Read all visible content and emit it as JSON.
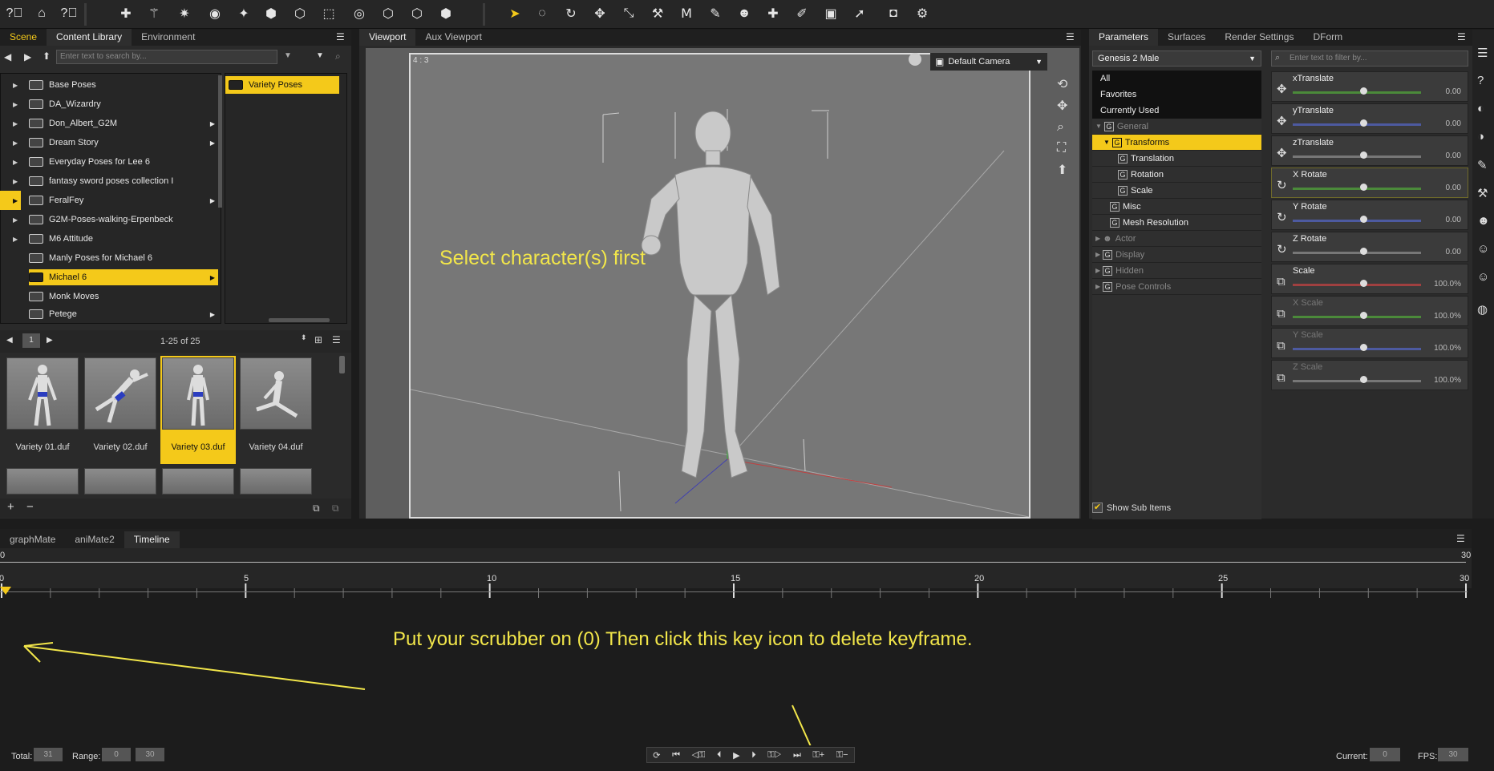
{
  "toolbar": {
    "icons": [
      "help-icon",
      "home-icon",
      "help-icon",
      "scene-icon",
      "tool-icon"
    ]
  },
  "left": {
    "tabs": [
      "Scene",
      "Content Library",
      "Environment"
    ],
    "search_placeholder": "Enter text to search by...",
    "tree": [
      "Base Poses",
      "DA_Wizardry",
      "Don_Albert_G2M",
      "Dream Story",
      "Everyday Poses for Lee 6",
      "fantasy sword poses collection I",
      "FeralFey",
      "G2M-Poses-walking-Erpenbeck",
      "M6 Attitude",
      "Manly Poses for Michael 6",
      "Michael 6",
      "Monk Moves",
      "Petege"
    ],
    "subfolder": "Variety Poses",
    "page": "1",
    "range": "1-25 of 25",
    "thumbs": [
      "Variety 01.duf",
      "Variety 02.duf",
      "Variety 03.duf",
      "Variety 04.duf"
    ]
  },
  "viewport": {
    "tabs": [
      "Viewport",
      "Aux Viewport"
    ],
    "aspect": "4 : 3",
    "camera": "Default Camera",
    "annotation": "Select character(s) first"
  },
  "params": {
    "tabs": [
      "Parameters",
      "Surfaces",
      "Render Settings",
      "DForm"
    ],
    "figure": "Genesis 2 Male",
    "filter_placeholder": "Enter text to filter by...",
    "list": [
      "All",
      "Favorites",
      "Currently Used",
      "General",
      "Transforms",
      "Translation",
      "Rotation",
      "Scale",
      "Misc",
      "Mesh Resolution",
      "Actor",
      "Display",
      "Hidden",
      "Pose Controls"
    ],
    "show_sub_items": "Show Sub Items",
    "sliders": [
      {
        "name": "xTranslate",
        "value": "0.00",
        "color": "#4b8a3a"
      },
      {
        "name": "yTranslate",
        "value": "0.00",
        "color": "#4d5aa0"
      },
      {
        "name": "zTranslate",
        "value": "0.00",
        "color": "#777777"
      },
      {
        "name": "X Rotate",
        "value": "0.00",
        "color": "#4b8a3a"
      },
      {
        "name": "Y Rotate",
        "value": "0.00",
        "color": "#4d5aa0"
      },
      {
        "name": "Z Rotate",
        "value": "0.00",
        "color": "#777777"
      },
      {
        "name": "Scale",
        "value": "100.0%",
        "color": "#a04040"
      },
      {
        "name": "X Scale",
        "value": "100.0%",
        "color": "#4b8a3a"
      },
      {
        "name": "Y Scale",
        "value": "100.0%",
        "color": "#4d5aa0"
      },
      {
        "name": "Z Scale",
        "value": "100.0%",
        "color": "#777777"
      }
    ]
  },
  "timeline": {
    "tabs": [
      "graphMate",
      "aniMate2",
      "Timeline"
    ],
    "top_left": "0",
    "top_right": "30",
    "ticks": [
      "0",
      "5",
      "10",
      "15",
      "20",
      "25",
      "30"
    ],
    "annotation": "Put your scrubber on (0) Then click this key icon to delete keyframe.",
    "total_label": "Total:",
    "total_value": "31",
    "range_label": "Range:",
    "range_start": "0",
    "range_end": "30",
    "current_label": "Current:",
    "current_value": "0",
    "fps_label": "FPS:",
    "fps_value": "30"
  },
  "colors": {
    "accent": "#f4c91a",
    "annotation": "#f2e64a"
  }
}
